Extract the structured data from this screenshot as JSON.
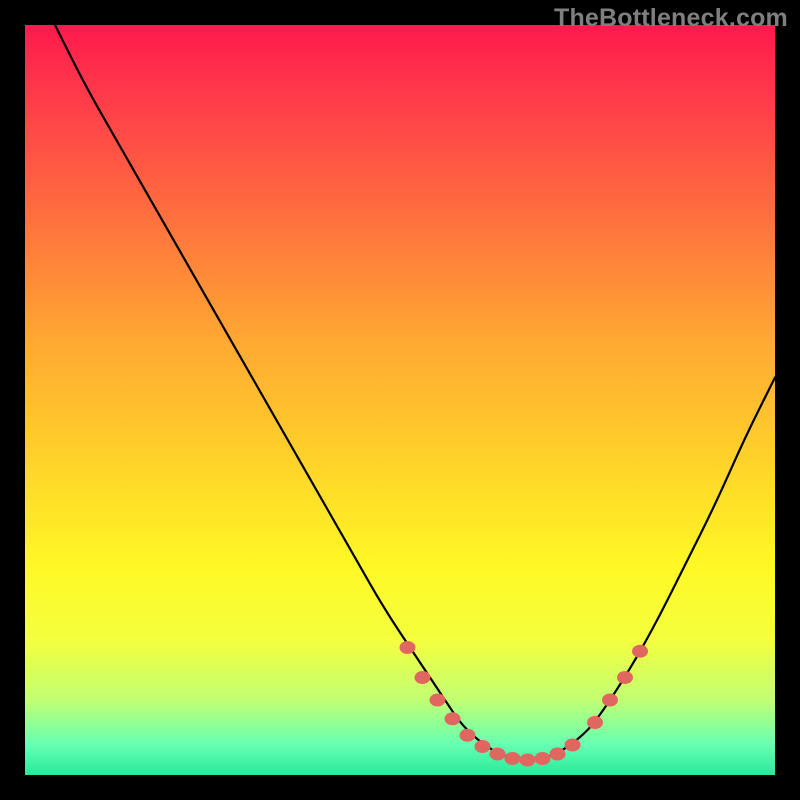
{
  "watermark": "TheBottleneck.com",
  "colors": {
    "page_bg": "#000000",
    "gradient_top": "#ff1a4d",
    "gradient_bottom": "#28e99b",
    "curve": "#000000",
    "dot": "#e0675f",
    "watermark": "#7f7f7f"
  },
  "chart_data": {
    "type": "line",
    "title": "",
    "xlabel": "",
    "ylabel": "",
    "xlim": [
      0,
      100
    ],
    "ylim": [
      0,
      100
    ],
    "grid": false,
    "legend": false,
    "series": [
      {
        "name": "bottleneck-curve",
        "x": [
          4,
          8,
          12,
          16,
          20,
          24,
          28,
          32,
          36,
          40,
          44,
          48,
          52,
          56,
          58,
          60,
          62,
          64,
          66,
          68,
          70,
          72,
          74,
          76,
          80,
          84,
          88,
          92,
          96,
          100
        ],
        "y": [
          100,
          92,
          85,
          78,
          71,
          64,
          57,
          50,
          43,
          36,
          29,
          22,
          16,
          10,
          7,
          5,
          3.5,
          2.5,
          2,
          2,
          2.5,
          3.5,
          5,
          7,
          13,
          20,
          28,
          36,
          45,
          53
        ]
      }
    ],
    "markers": {
      "name": "highlight-dots",
      "x": [
        51,
        53,
        55,
        57,
        59,
        61,
        63,
        65,
        67,
        69,
        71,
        73,
        76,
        78,
        80,
        82
      ],
      "y": [
        17,
        13,
        10,
        7.5,
        5.3,
        3.8,
        2.8,
        2.2,
        2,
        2.2,
        2.8,
        4,
        7,
        10,
        13,
        16.5
      ]
    },
    "note": "Axis values are percentages (0–100) estimated from the image; no numeric labels or axis ticks are rendered."
  }
}
